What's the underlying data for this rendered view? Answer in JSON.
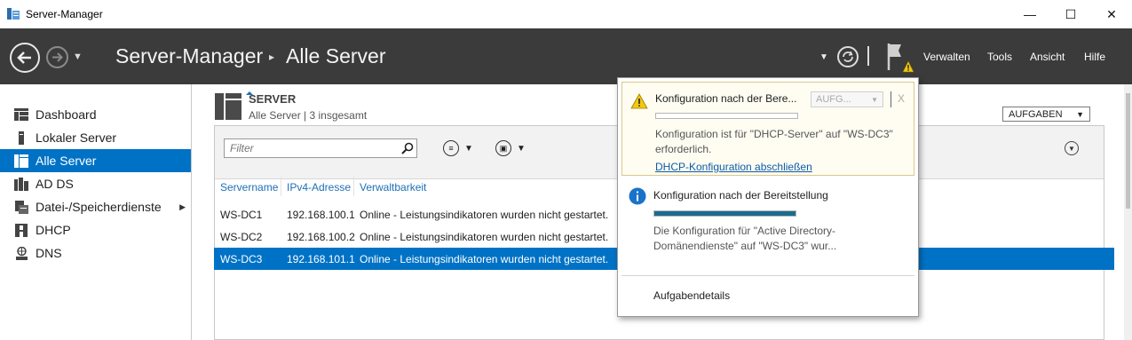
{
  "window": {
    "title": "Server-Manager",
    "minimize": "—",
    "maximize": "☐",
    "close": "✕"
  },
  "header": {
    "breadcrumb_root": "Server-Manager",
    "breadcrumb_sep": "▸",
    "breadcrumb_current": "Alle Server",
    "menu": [
      "Verwalten",
      "Tools",
      "Ansicht",
      "Hilfe"
    ]
  },
  "sidebar": {
    "items": [
      {
        "label": "Dashboard",
        "icon": "dashboard-icon"
      },
      {
        "label": "Lokaler Server",
        "icon": "local-server-icon"
      },
      {
        "label": "Alle Server",
        "icon": "all-servers-icon",
        "active": true
      },
      {
        "label": "AD DS",
        "icon": "ad-ds-icon"
      },
      {
        "label": "Datei-/Speicherdienste",
        "icon": "file-storage-icon",
        "expandable": true
      },
      {
        "label": "DHCP",
        "icon": "dhcp-icon"
      },
      {
        "label": "DNS",
        "icon": "dns-icon"
      }
    ]
  },
  "server_section": {
    "title": "SERVER",
    "subtitle": "Alle Server | 3 insgesamt",
    "tasks_label": "AUFGABEN",
    "filter_placeholder": "Filter",
    "columns": [
      "Servername",
      "IPv4-Adresse",
      "Verwaltbarkeit"
    ],
    "rows": [
      {
        "name": "WS-DC1",
        "ip": "192.168.100.1",
        "status": "Online - Leistungsindikatoren wurden nicht gestartet."
      },
      {
        "name": "WS-DC2",
        "ip": "192.168.100.2",
        "status": "Online - Leistungsindikatoren wurden nicht gestartet."
      },
      {
        "name": "WS-DC3",
        "ip": "192.168.101.1",
        "status": "Online - Leistungsindikatoren wurden nicht gestartet.",
        "selected": true
      }
    ]
  },
  "notifications": {
    "items": [
      {
        "type": "warning",
        "title": "Konfiguration nach der Bere...",
        "task_button": "AUFG...",
        "close": "X",
        "progress": 0,
        "message": "Konfiguration ist für \"DHCP-Server\" auf \"WS-DC3\" erforderlich.",
        "link": "DHCP-Konfiguration abschließen"
      },
      {
        "type": "info",
        "title": "Konfiguration nach der Bereitstellung",
        "progress": 1.0,
        "message": "Die Konfiguration für \"Active Directory-Domänendienste\" auf \"WS-DC3\" wur..."
      }
    ],
    "details_label": "Aufgabendetails"
  },
  "colors": {
    "header_bg": "#3b3b3b",
    "accent": "#0072c6",
    "progress_fill": "#1c6b8f",
    "warning": "#f2c811",
    "info": "#1a73c9"
  }
}
